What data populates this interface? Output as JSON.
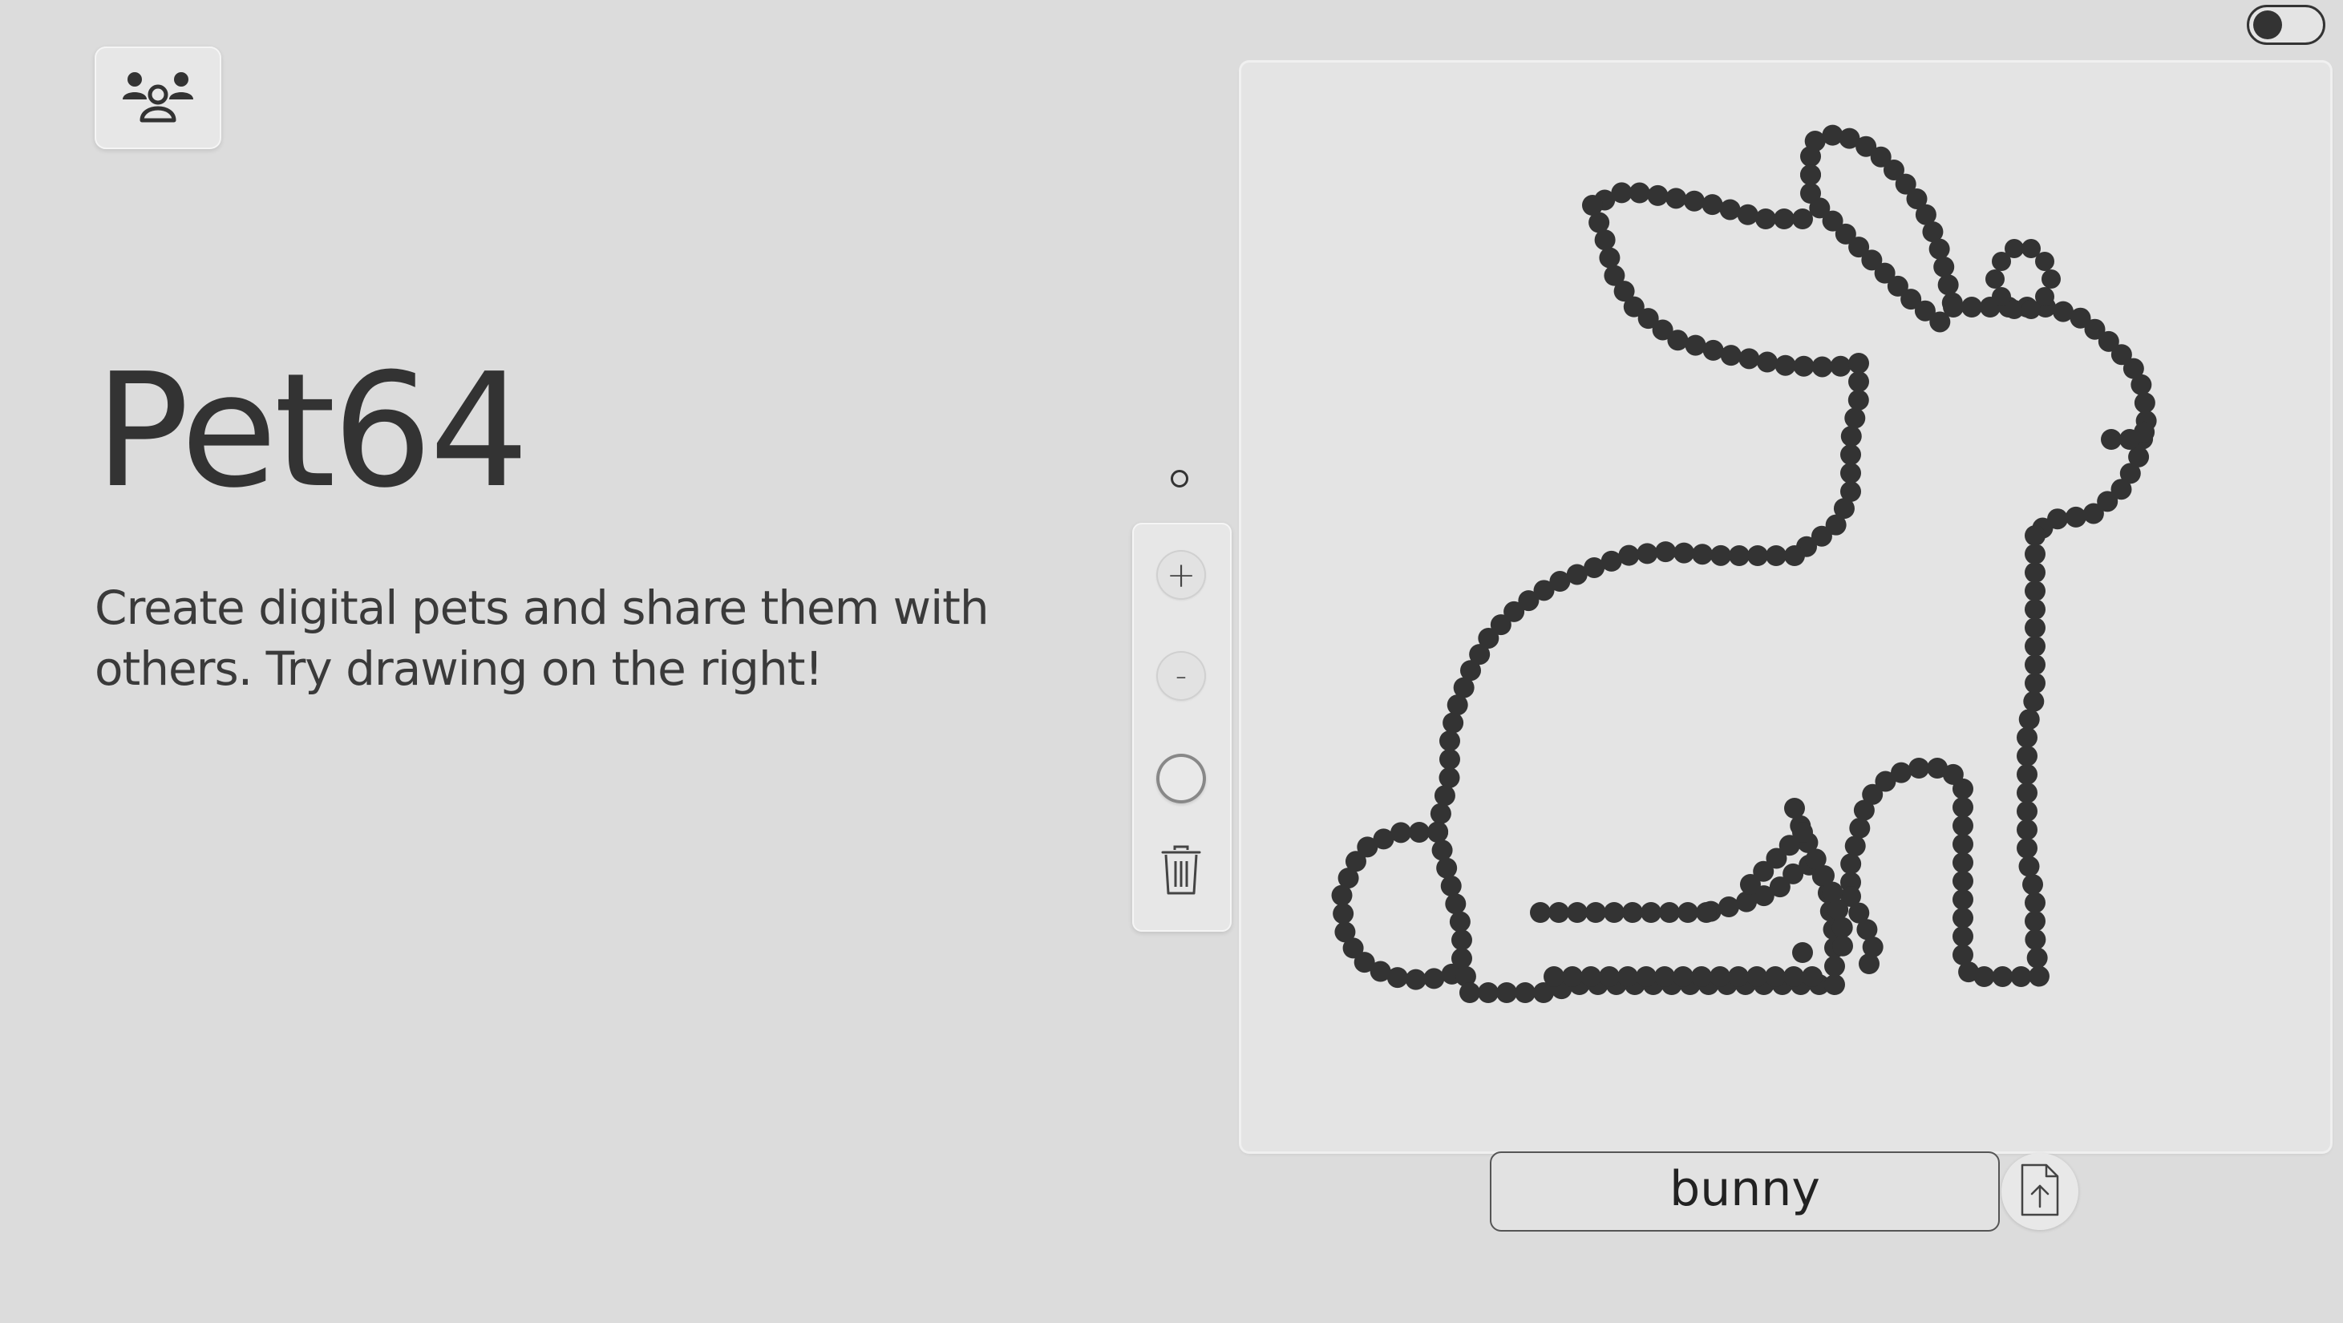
{
  "app": {
    "title": "Pet64",
    "description": "Create digital pets and share them with others. Try drawing on the right!"
  },
  "header": {
    "community_icon": "people-group-icon",
    "theme_toggle_state": "off"
  },
  "toolbar": {
    "zoom_in_label": "+",
    "zoom_out_label": "-",
    "brush_icon": "circle-brush-icon",
    "clear_icon": "trash-icon"
  },
  "pet": {
    "name_value": "bunny",
    "upload_icon": "file-upload-icon"
  },
  "colors": {
    "background": "#dcdcdc",
    "panel": "#e4e4e4",
    "ink": "#333333"
  }
}
